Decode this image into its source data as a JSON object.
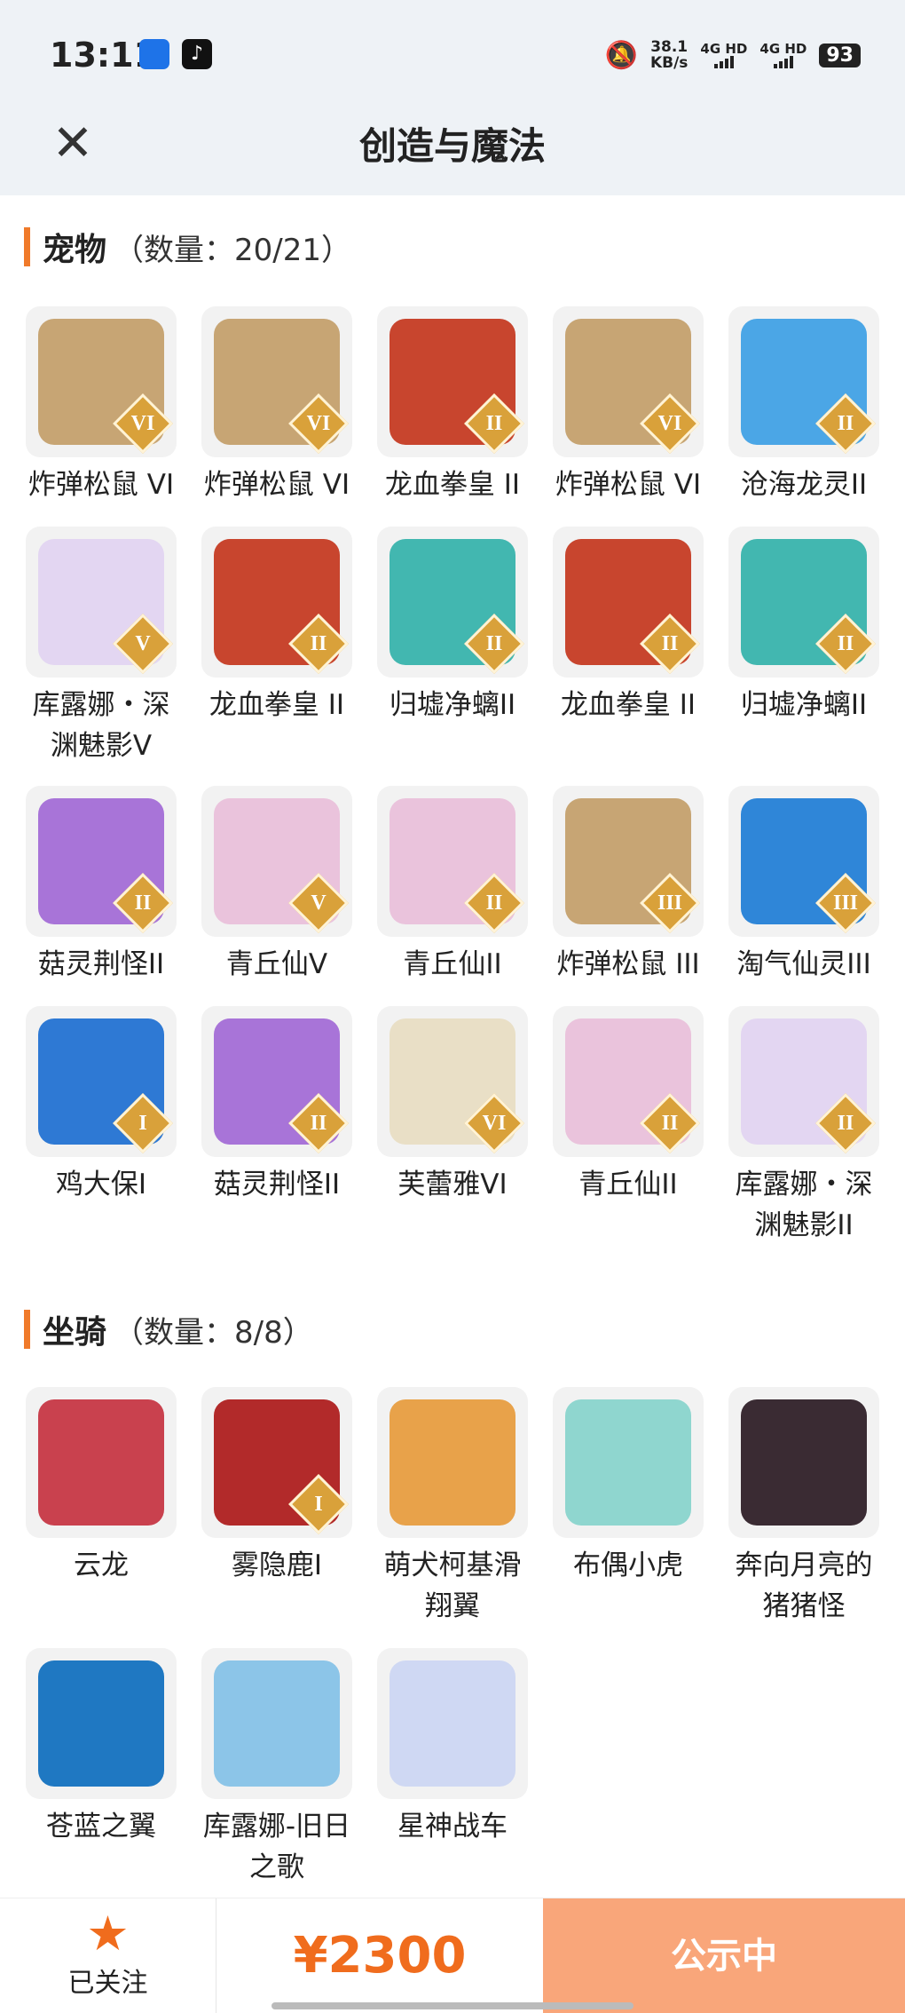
{
  "status_bar": {
    "time": "13:11",
    "net_speed_value": "38.1",
    "net_speed_unit": "KB/s",
    "sim1": "4G HD",
    "sim2": "4G HD",
    "battery": "93",
    "icons": [
      "app-icon",
      "tiktok-icon",
      "mute-bell-icon"
    ]
  },
  "header": {
    "title": "创造与魔法",
    "close_icon": "close-icon"
  },
  "pets": {
    "title": "宠物",
    "count": "（数量：20/21）",
    "items": [
      {
        "name": "炸弹松鼠 VI",
        "badge": "VI",
        "color": "#c7a574"
      },
      {
        "name": "炸弹松鼠 VI",
        "badge": "VI",
        "color": "#c7a574"
      },
      {
        "name": "龙血拳皇 II",
        "badge": "II",
        "color": "#c8452e"
      },
      {
        "name": "炸弹松鼠 VI",
        "badge": "VI",
        "color": "#c7a574"
      },
      {
        "name": "沧海龙灵II",
        "badge": "II",
        "color": "#4ba6e6"
      },
      {
        "name": "库露娜・深渊魅影V",
        "badge": "V",
        "color": "#e3d6f2"
      },
      {
        "name": "龙血拳皇 II",
        "badge": "II",
        "color": "#c8452e"
      },
      {
        "name": "归墟净螭II",
        "badge": "II",
        "color": "#42b7b0"
      },
      {
        "name": "龙血拳皇 II",
        "badge": "II",
        "color": "#c8452e"
      },
      {
        "name": "归墟净螭II",
        "badge": "II",
        "color": "#42b7b0"
      },
      {
        "name": "菇灵荆怪II",
        "badge": "II",
        "color": "#a874d8"
      },
      {
        "name": "青丘仙V",
        "badge": "V",
        "color": "#eac3dc"
      },
      {
        "name": "青丘仙II",
        "badge": "II",
        "color": "#eac3dc"
      },
      {
        "name": "炸弹松鼠 III",
        "badge": "III",
        "color": "#c7a574"
      },
      {
        "name": "淘气仙灵III",
        "badge": "III",
        "color": "#2f86d8"
      },
      {
        "name": "鸡大保I",
        "badge": "I",
        "color": "#2e79d4"
      },
      {
        "name": "菇灵荆怪II",
        "badge": "II",
        "color": "#a874d8"
      },
      {
        "name": "芙蕾雅VI",
        "badge": "VI",
        "color": "#e9dfc6"
      },
      {
        "name": "青丘仙II",
        "badge": "II",
        "color": "#eac3dc"
      },
      {
        "name": "库露娜・深渊魅影II",
        "badge": "II",
        "color": "#e3d6f2"
      }
    ]
  },
  "mounts": {
    "title": "坐骑",
    "count": "（数量：8/8）",
    "items": [
      {
        "name": "云龙",
        "badge": "",
        "color": "#c9414e"
      },
      {
        "name": "雾隐鹿I",
        "badge": "I",
        "color": "#b22a2a"
      },
      {
        "name": "萌犬柯基滑翔翼",
        "badge": "",
        "color": "#e8a24a"
      },
      {
        "name": "布偶小虎",
        "badge": "",
        "color": "#8fd6cf"
      },
      {
        "name": "奔向月亮的猪猪怪",
        "badge": "",
        "color": "#3a2b33"
      },
      {
        "name": "苍蓝之翼",
        "badge": "",
        "color": "#1f78c2"
      },
      {
        "name": "库露娜-旧日之歌",
        "badge": "",
        "color": "#8cc5e8"
      },
      {
        "name": "星神战车",
        "badge": "",
        "color": "#cfd8f3"
      }
    ]
  },
  "bottom_bar": {
    "follow_label": "已关注",
    "price": "¥2300",
    "status_button": "公示中"
  }
}
